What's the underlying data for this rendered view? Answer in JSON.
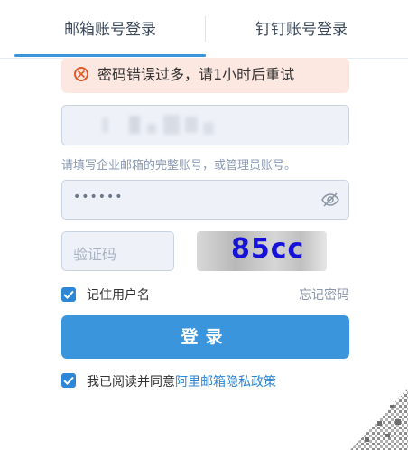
{
  "tabs": {
    "email_login": "邮箱账号登录",
    "dingtalk_login": "钉钉账号登录"
  },
  "error": {
    "message": "密码错误过多，请1小时后重试",
    "color": "#e05a2c"
  },
  "account": {
    "hint": "请填写企业邮箱的完整账号，或管理员账号。"
  },
  "password": {
    "masked": "••••••"
  },
  "captcha": {
    "placeholder": "验证码",
    "code": "85cc"
  },
  "remember": {
    "label": "记住用户名",
    "checked": true
  },
  "forgot_password": "忘记密码",
  "login_button": "登录",
  "agreement": {
    "prefix": "我已阅读并同意",
    "link": "阿里邮箱隐私政策",
    "checked": true
  },
  "colors": {
    "accent": "#3a95dc",
    "link": "#2e86d6"
  }
}
